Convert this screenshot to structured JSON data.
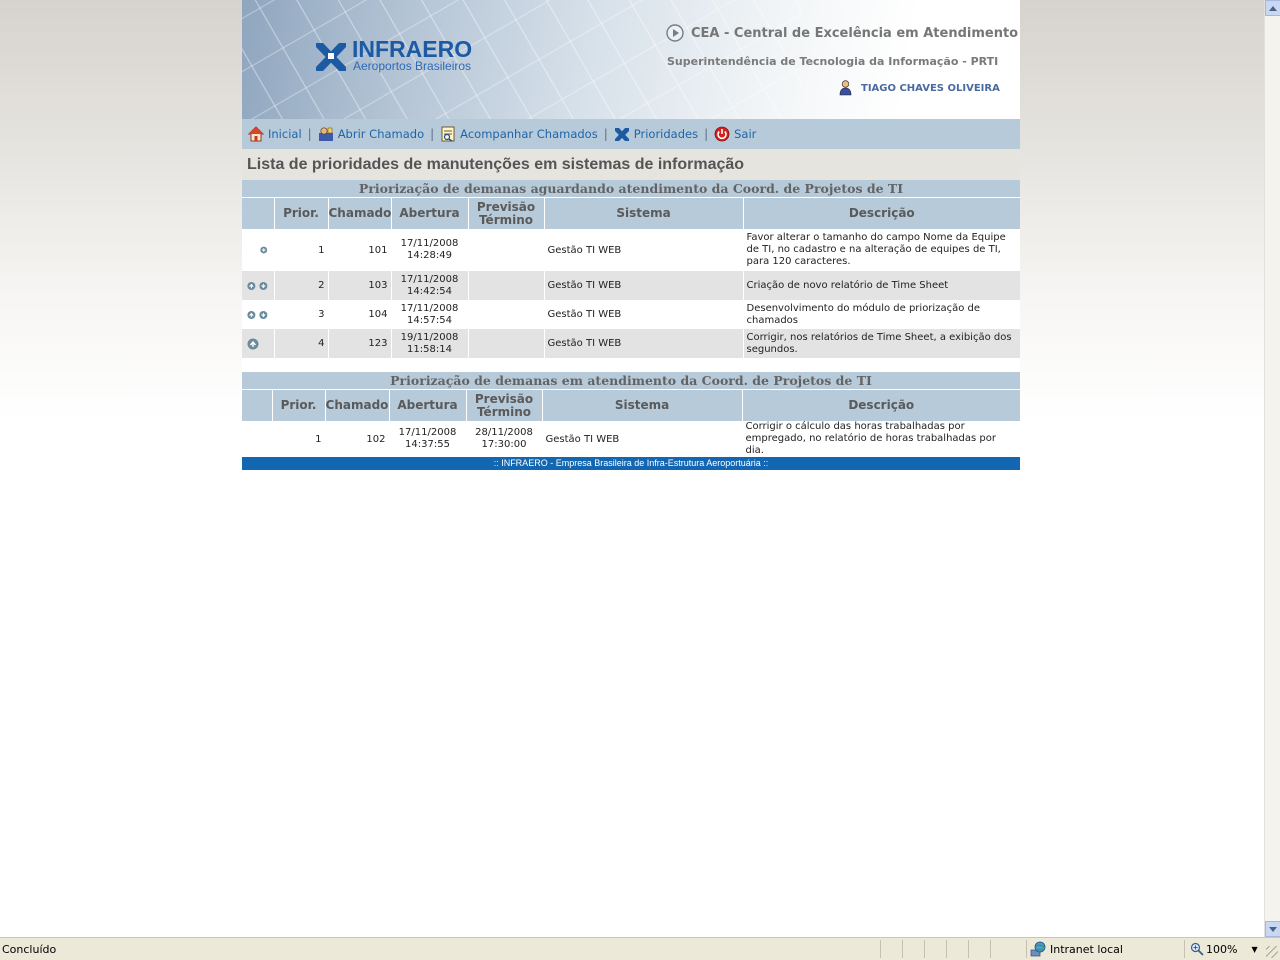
{
  "header": {
    "logo_name": "INFRAERO",
    "logo_sub": "Aeroportos Brasileiros",
    "cea_title": "CEA - Central de Excelência em Atendimento",
    "sup_title": "Superintendência de Tecnologia da Informação - PRTI",
    "user_name": "TIAGO CHAVES OLIVEIRA"
  },
  "nav": {
    "items": [
      {
        "label": "Inicial",
        "icon": "home-icon"
      },
      {
        "label": "Abrir Chamado",
        "icon": "open-ticket-icon"
      },
      {
        "label": "Acompanhar Chamados",
        "icon": "track-tickets-icon"
      },
      {
        "label": "Prioridades",
        "icon": "priorities-icon"
      },
      {
        "label": "Sair",
        "icon": "exit-icon"
      }
    ]
  },
  "page_title": "Lista de prioridades de manutenções em sistemas de informação",
  "columns": {
    "prior": "Prior.",
    "chamado": "Chamado",
    "abertura": "Abertura",
    "previsao_1": "Previsão",
    "previsao_2": "Término",
    "sistema": "Sistema",
    "descricao": "Descrição"
  },
  "table1": {
    "title": "Priorização de demanas aguardando atendimento da Coord. de Projetos de TI",
    "rows": [
      {
        "prior": "1",
        "chamado": "101",
        "abertura_date": "17/11/2008",
        "abertura_time": "14:28:49",
        "previsao_date": "",
        "previsao_time": "",
        "sistema": "Gestão TI WEB",
        "descricao": "Favor alterar o tamanho do campo Nome da Equipe de TI, no cadastro e na alteração de equipes de TI, para 120 caracteres."
      },
      {
        "prior": "2",
        "chamado": "103",
        "abertura_date": "17/11/2008",
        "abertura_time": "14:42:54",
        "previsao_date": "",
        "previsao_time": "",
        "sistema": "Gestão TI WEB",
        "descricao": "Criação de novo relatório de Time Sheet"
      },
      {
        "prior": "3",
        "chamado": "104",
        "abertura_date": "17/11/2008",
        "abertura_time": "14:57:54",
        "previsao_date": "",
        "previsao_time": "",
        "sistema": "Gestão TI WEB",
        "descricao": "Desenvolvimento do módulo de priorização de chamados"
      },
      {
        "prior": "4",
        "chamado": "123",
        "abertura_date": "19/11/2008",
        "abertura_time": "11:58:14",
        "previsao_date": "",
        "previsao_time": "",
        "sistema": "Gestão TI WEB",
        "descricao": "Corrigir, nos relatórios de Time Sheet, a exibição dos segundos."
      }
    ]
  },
  "table2": {
    "title": "Priorização de demanas em atendimento da Coord. de Projetos de TI",
    "rows": [
      {
        "prior": "1",
        "chamado": "102",
        "abertura_date": "17/11/2008",
        "abertura_time": "14:37:55",
        "previsao_date": "28/11/2008",
        "previsao_time": "17:30:00",
        "sistema": "Gestão TI WEB",
        "descricao": "Corrigir o cálculo das horas trabalhadas por empregado, no relatório de horas trabalhadas por dia."
      }
    ]
  },
  "footer": ":: INFRAERO - Empresa Brasileira de Infra-Estrutura Aeroportuária ::",
  "statusbar": {
    "status": "Concluído",
    "zone": "Intranet local",
    "zoom": "100%"
  },
  "colors": {
    "accent_blue": "#1367b2",
    "table_header": "#b7cad9",
    "nav_link": "#1f64a8"
  }
}
